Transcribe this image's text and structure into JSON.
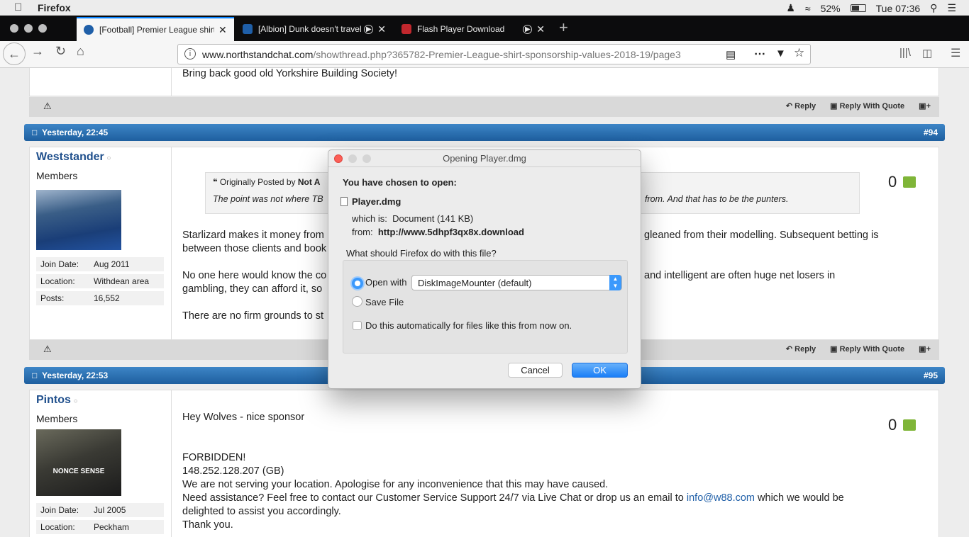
{
  "menubar": {
    "app": "Firefox",
    "battery": "52%",
    "time": "Tue 07:36"
  },
  "tabs": [
    {
      "title": "[Football] Premier League shirt",
      "fav_color": "#1f5fa8"
    },
    {
      "title": "[Albion] Dunk doesn't travel",
      "fav_color": "#1f5fa8"
    },
    {
      "title": "Flash Player Download",
      "fav_color": "#c1272d"
    }
  ],
  "urlbar": {
    "host": "www.northstandchat.com",
    "path": "/showthread.php?365782-Premier-League-shirt-sponsorship-values-2018-19/page3"
  },
  "post_top": {
    "text": "Bring back good old Yorkshire Building Society!"
  },
  "actions": {
    "reply": "Reply",
    "reply_quote": "Reply With Quote"
  },
  "post94": {
    "date": "Yesterday, 22:45",
    "number": "#94",
    "user": "Weststander",
    "role": "Members",
    "join_label": "Join Date:",
    "join": "Aug 2011",
    "loc_label": "Location:",
    "location": "Withdean area",
    "posts_label": "Posts:",
    "posts": "16,552",
    "quote_header": "Originally Posted by",
    "quote_author": "Not A",
    "quote_text_a": "The point was not where TB",
    "quote_text_b": "from. And that has to be the punters.",
    "p1a": "Starlizard makes it money from",
    "p1b": "gleaned from their modelling. Subsequent betting is",
    "p1c": "between those clients and book",
    "p2a": "No one here would know the co",
    "p2b": "and intelligent are often huge net losers in",
    "p2c": "gambling, they can afford it, so",
    "p3": "There are no firm grounds to st",
    "likes": "0"
  },
  "post95": {
    "date": "Yesterday, 22:53",
    "number": "#95",
    "user": "Pintos",
    "role": "Members",
    "join_label": "Join Date:",
    "join": "Jul 2005",
    "loc_label": "Location:",
    "location": "Peckham",
    "line1": "Hey Wolves - nice sponsor",
    "line2": "FORBIDDEN!",
    "line3": "148.252.128.207 (GB)",
    "line4": "We are not serving your location. Apologise for any inconvenience that this may have caused.",
    "line5a": "Need assistance? Feel free to contact our Customer Service Support 24/7 via Live Chat or drop us an email to ",
    "line5link": "info@w88.com",
    "line5b": " which we would be",
    "line6": "delighted to assist you accordingly.",
    "line7": "Thank you.",
    "likes": "0",
    "avatar_text": "NONCE SENSE"
  },
  "dialog": {
    "title": "Opening Player.dmg",
    "chosen": "You have chosen to open:",
    "filename": "Player.dmg",
    "which_label": "which is:",
    "which": "Document (141 KB)",
    "from_label": "from:",
    "from": "http://www.5dhpf3qx8x.download",
    "question": "What should Firefox do with this file?",
    "open_with": "Open with",
    "app": "DiskImageMounter (default)",
    "save": "Save File",
    "auto": "Do this automatically for files like this from now on.",
    "cancel": "Cancel",
    "ok": "OK"
  }
}
